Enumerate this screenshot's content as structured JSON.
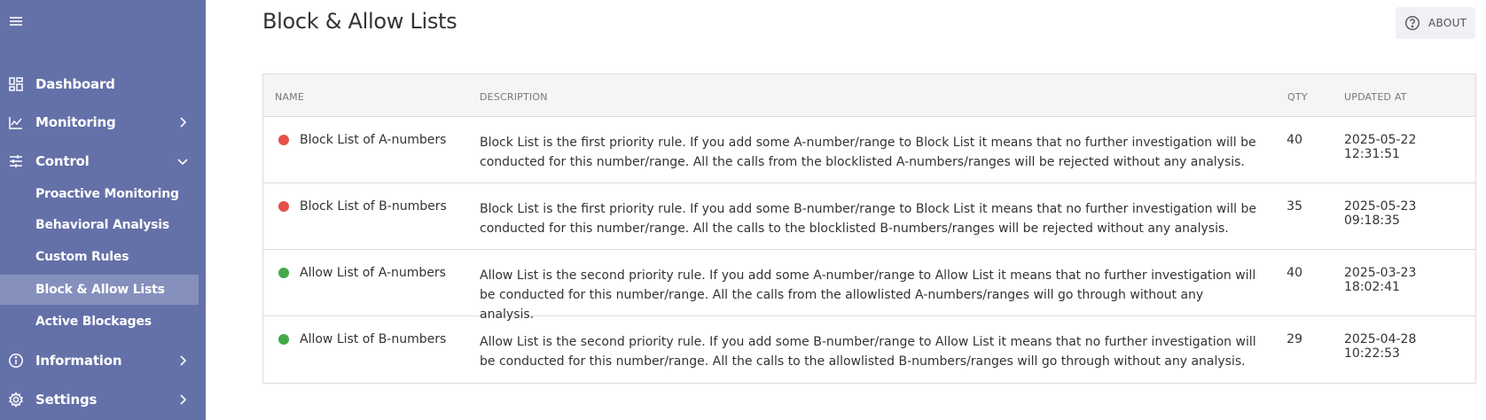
{
  "sidebar": {
    "menu_icon": "hamburger-icon",
    "items": [
      {
        "label": "Dashboard",
        "icon": "dashboard-icon"
      },
      {
        "label": "Monitoring",
        "icon": "chart-icon"
      },
      {
        "label": "Control",
        "icon": "sliders-icon"
      },
      {
        "label": "Information",
        "icon": "info-icon"
      },
      {
        "label": "Settings",
        "icon": "gear-icon"
      }
    ],
    "control_sub_items": [
      {
        "label": "Proactive Monitoring"
      },
      {
        "label": "Behavioral Analysis"
      },
      {
        "label": "Custom Rules"
      },
      {
        "label": "Block & Allow Lists",
        "active": true
      },
      {
        "label": "Active Blockages"
      }
    ],
    "background_color": "#6470a8",
    "active_color": "#8690bd"
  },
  "page": {
    "title": "Block & Allow Lists",
    "about_label": "ABOUT"
  },
  "table": {
    "columns": {
      "name": "NAME",
      "description": "DESCRIPTION",
      "qty": "QTY",
      "updated_at": "UPDATED AT"
    },
    "rows": [
      {
        "status": "block",
        "status_color": "#e5504a",
        "name": "Block List of A-numbers",
        "description": "Block List is the first priority rule. If you add some A-number/range to Block List it means that no further investigation will be conducted for this number/range. All the calls from the blocklisted A-numbers/ranges will be rejected without any analysis.",
        "qty": "40",
        "updated_at": "2025-05-22 12:31:51"
      },
      {
        "status": "block",
        "status_color": "#e5504a",
        "name": "Block List of B-numbers",
        "description": "Block List is the first priority rule. If you add some B-number/range to Block List it means that no further investigation will be conducted for this number/range. All the calls to the blocklisted B-numbers/ranges will be rejected without any analysis.",
        "qty": "35",
        "updated_at": "2025-05-23 09:18:35"
      },
      {
        "status": "allow",
        "status_color": "#43a94a",
        "name": "Allow List of A-numbers",
        "description": "Allow List is the second priority rule. If you add some A-number/range to Allow List it means that no further investigation will be conducted for this number/range. All the calls from the allowlisted A-numbers/ranges will go through without any analysis.",
        "qty": "40",
        "updated_at": "2025-03-23 18:02:41"
      },
      {
        "status": "allow",
        "status_color": "#43a94a",
        "name": "Allow List of B-numbers",
        "description": "Allow List is the second priority rule. If you add some B-number/range to Allow List it means that no further investigation will be conducted for this number/range. All the calls to the allowlisted B-numbers/ranges will go through without any analysis.",
        "qty": "29",
        "updated_at": "2025-04-28 10:22:53"
      }
    ]
  }
}
